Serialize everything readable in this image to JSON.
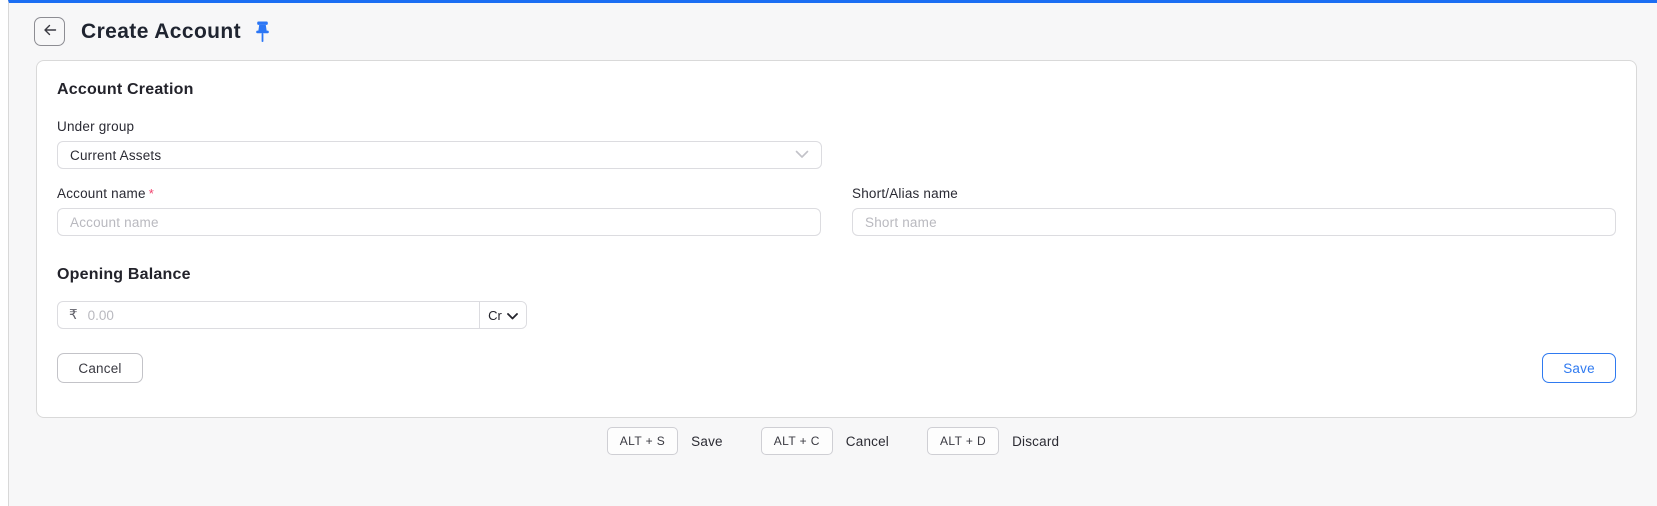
{
  "header": {
    "title": "Create Account"
  },
  "form": {
    "section_title": "Account Creation",
    "under_group": {
      "label": "Under group",
      "value": "Current Assets"
    },
    "account_name": {
      "label": "Account name",
      "required_mark": "*",
      "placeholder": "Account name"
    },
    "short_alias": {
      "label": "Short/Alias name",
      "placeholder": "Short name"
    },
    "opening_balance": {
      "title": "Opening Balance",
      "currency_symbol": "₹",
      "placeholder": "0.00",
      "cr_dr_value": "Cr"
    },
    "cancel_label": "Cancel",
    "save_label": "Save"
  },
  "shortcuts": [
    {
      "keys": "ALT + S",
      "action": "Save"
    },
    {
      "keys": "ALT + C",
      "action": "Cancel"
    },
    {
      "keys": "ALT + D",
      "action": "Discard"
    }
  ],
  "colors": {
    "accent_blue": "#1b6ef3",
    "required_red": "#f1416c",
    "background": "#f7f7f8"
  }
}
